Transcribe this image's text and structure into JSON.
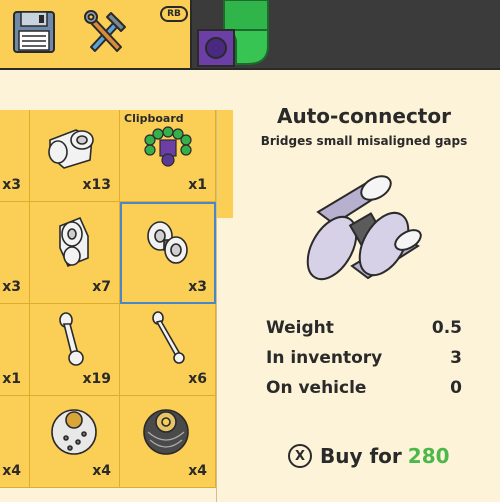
{
  "toolbar": {
    "save_icon": "floppy-disk-icon",
    "tools_icon": "hammer-wrench-icon",
    "rb_label": "RB"
  },
  "grid": {
    "clipboard_label": "Clipboard",
    "cells": [
      {
        "count": "x3"
      },
      {
        "count": "x13"
      },
      {
        "count": "x1"
      },
      {
        "count": "x3"
      },
      {
        "count": "x7"
      },
      {
        "count": "x3"
      },
      {
        "count": "x1"
      },
      {
        "count": "x19"
      },
      {
        "count": "x6"
      },
      {
        "count": "x4"
      },
      {
        "count": "x4"
      },
      {
        "count": "x4"
      }
    ]
  },
  "info": {
    "title": "Auto-connector",
    "subtitle": "Bridges small misaligned gaps",
    "stats": [
      {
        "label": "Weight",
        "value": "0.5"
      },
      {
        "label": "In inventory",
        "value": "3"
      },
      {
        "label": "On vehicle",
        "value": "0"
      }
    ],
    "buy_button_glyph": "X",
    "buy_label": "Buy for",
    "buy_price": "280"
  },
  "colors": {
    "panel_bg": "#fdf3d8",
    "cell_bg": "#fbcf55",
    "selected_outline": "#4a87c6",
    "price_green": "#4cb84c",
    "background": "#3b3b3b"
  }
}
